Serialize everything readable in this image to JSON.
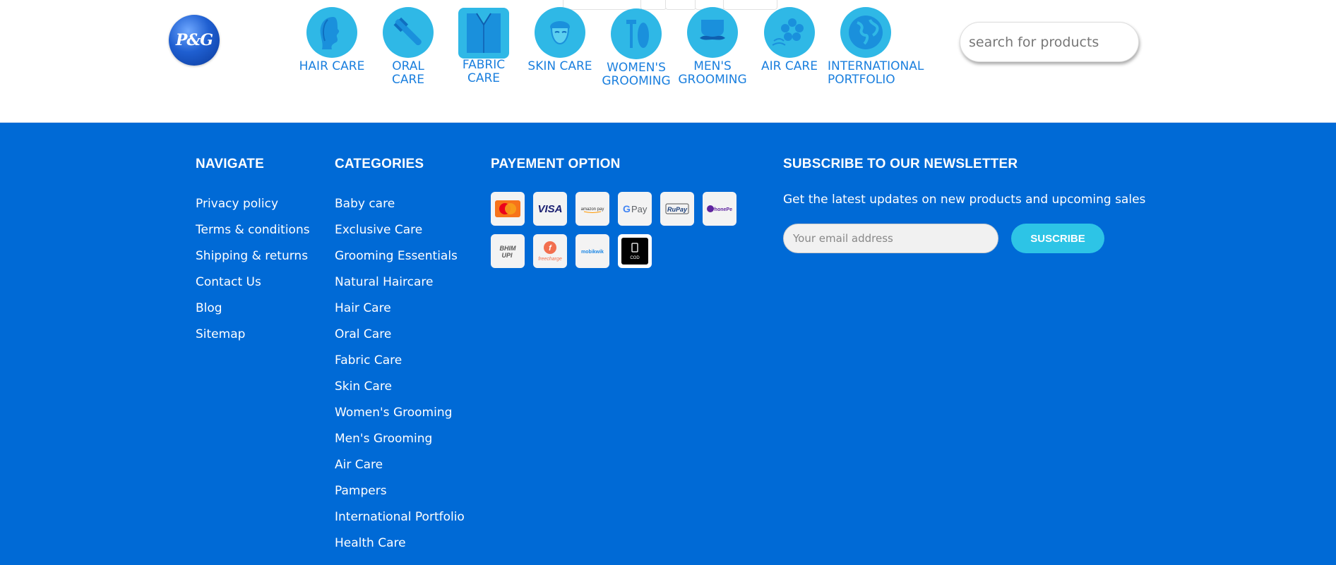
{
  "header": {
    "logo_text": "P&G",
    "search_placeholder": "search for products",
    "categories": [
      {
        "label": "HAIR CARE",
        "icon": "woman-face-icon"
      },
      {
        "label": "ORAL\nCARE",
        "icon": "toothbrush-icon"
      },
      {
        "label": "FABRIC\nCARE",
        "icon": "shirt-icon"
      },
      {
        "label": "SKIN CARE",
        "icon": "face-mask-icon"
      },
      {
        "label": "WOMEN'S\nGROOMING",
        "icon": "razor-pad-icon"
      },
      {
        "label": "MEN'S\nGROOMING",
        "icon": "mustache-icon"
      },
      {
        "label": "AIR CARE",
        "icon": "flower-icon"
      },
      {
        "label": "INTERNATIONAL\nPORTFOLIO",
        "icon": "globe-icon"
      }
    ]
  },
  "footer": {
    "navigate": {
      "heading": "NAVIGATE",
      "items": [
        "Privacy policy",
        "Terms & conditions",
        "Shipping & returns",
        "Contact Us",
        "Blog",
        "Sitemap"
      ]
    },
    "categories": {
      "heading": "CATEGORIES",
      "items": [
        "Baby care",
        "Exclusive Care",
        "Grooming Essentials",
        "Natural Haircare",
        "Hair Care",
        "Oral Care",
        "Fabric Care",
        "Skin Care",
        "Women's Grooming",
        "Men's Grooming",
        "Air Care",
        "Pampers",
        "International Portfolio",
        "Health Care"
      ]
    },
    "payment": {
      "heading": "PAYEMENT OPTION",
      "methods": [
        {
          "name": "MasterCard",
          "icon": "mastercard-icon"
        },
        {
          "name": "VISA",
          "icon": "visa-icon"
        },
        {
          "name": "amazon pay",
          "icon": "amazon-pay-icon"
        },
        {
          "name": "G Pay",
          "icon": "google-pay-icon"
        },
        {
          "name": "RuPay",
          "icon": "rupay-icon"
        },
        {
          "name": "PhonePe",
          "icon": "phonepe-icon"
        },
        {
          "name": "BHIM UPI",
          "icon": "bhim-upi-icon"
        },
        {
          "name": "freecharge",
          "icon": "freecharge-icon"
        },
        {
          "name": "mobikwik",
          "icon": "mobikwik-icon"
        },
        {
          "name": "COD",
          "icon": "cod-icon"
        }
      ]
    },
    "newsletter": {
      "heading": "SUBSCRIBE TO OUR NEWSLETTER",
      "text": "Get the latest updates on new products and upcoming sales",
      "email_placeholder": "Your email address",
      "button": "SUSCRIBE"
    }
  },
  "colors": {
    "footer_bg": "#006ad6",
    "category_icon_bg": "#2fb8e6",
    "category_label": "#1a7fde",
    "subscribe_button": "#2dc4e6"
  }
}
